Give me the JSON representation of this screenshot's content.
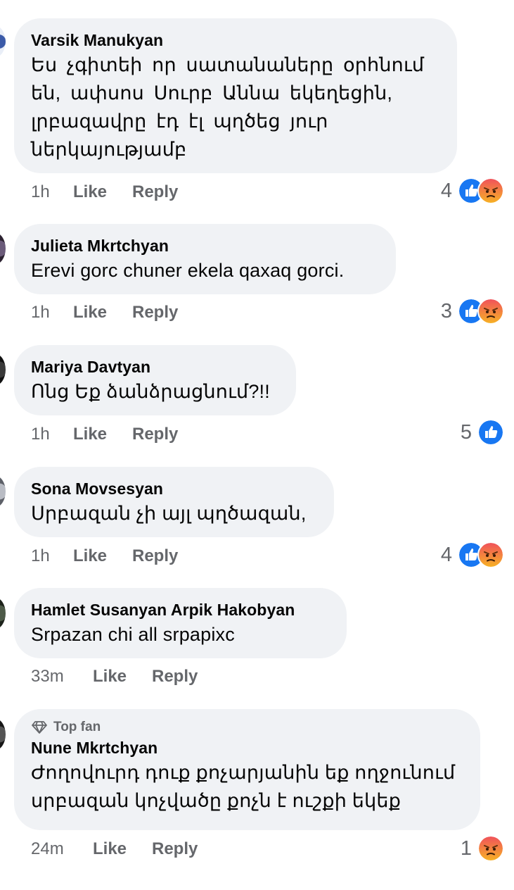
{
  "comments": [
    {
      "author": "Varsik  Manukyan",
      "text": [
        "Ես չգիտեի որ սատանաները օրհնում",
        "են, ափսոս Սուրբ Աննա եկեղեցին,",
        "լրբազավրը էդ էլ պղծեց յուր",
        "ներկայությամբ"
      ],
      "time": "1h",
      "like_label": "Like",
      "reply_label": "Reply",
      "reaction_count": "4",
      "reactions": [
        "like",
        "angry"
      ]
    },
    {
      "author": "Julieta Mkrtchyan",
      "text": [
        "Erevi gorc chuner ekela qaxaq gorci."
      ],
      "time": "1h",
      "like_label": "Like",
      "reply_label": "Reply",
      "reaction_count": "3",
      "reactions": [
        "like",
        "angry"
      ]
    },
    {
      "author": "Mariya Davtyan",
      "text": [
        "Ոնց Եք ձանձրացնում?!!"
      ],
      "time": "1h",
      "like_label": "Like",
      "reply_label": "Reply",
      "reaction_count": "5",
      "reactions": [
        "like"
      ]
    },
    {
      "author": "Sona Movsesyan",
      "text": [
        "Սրբազան չի այլ պղծազան,"
      ],
      "time": "1h",
      "like_label": "Like",
      "reply_label": "Reply",
      "reaction_count": "4",
      "reactions": [
        "like",
        "angry"
      ]
    },
    {
      "author": "Hamlet Susanyan Arpik Hakobyan",
      "text": [
        "Srpazan chi all srpapixc"
      ],
      "time": "33m",
      "like_label": "Like",
      "reply_label": "Reply",
      "reaction_count": null,
      "reactions": []
    },
    {
      "badge": "Top fan",
      "badge_icon": "diamond-icon",
      "author": "Nune Mkrtchyan",
      "text": [
        "Ժողովուրդ դուք քոչարյանին եք ողջունում",
        "սրբազան կոչվածը քոչն է ուշքի եկեք"
      ],
      "time": "24m",
      "like_label": "Like",
      "reply_label": "Reply",
      "reaction_count": "1",
      "reactions": [
        "angry"
      ]
    }
  ],
  "colors": {
    "bubble_bg": "#f0f2f5",
    "meta_text": "#65676b",
    "like_blue": "#1877f2",
    "angry_orange": "#e9710f"
  }
}
